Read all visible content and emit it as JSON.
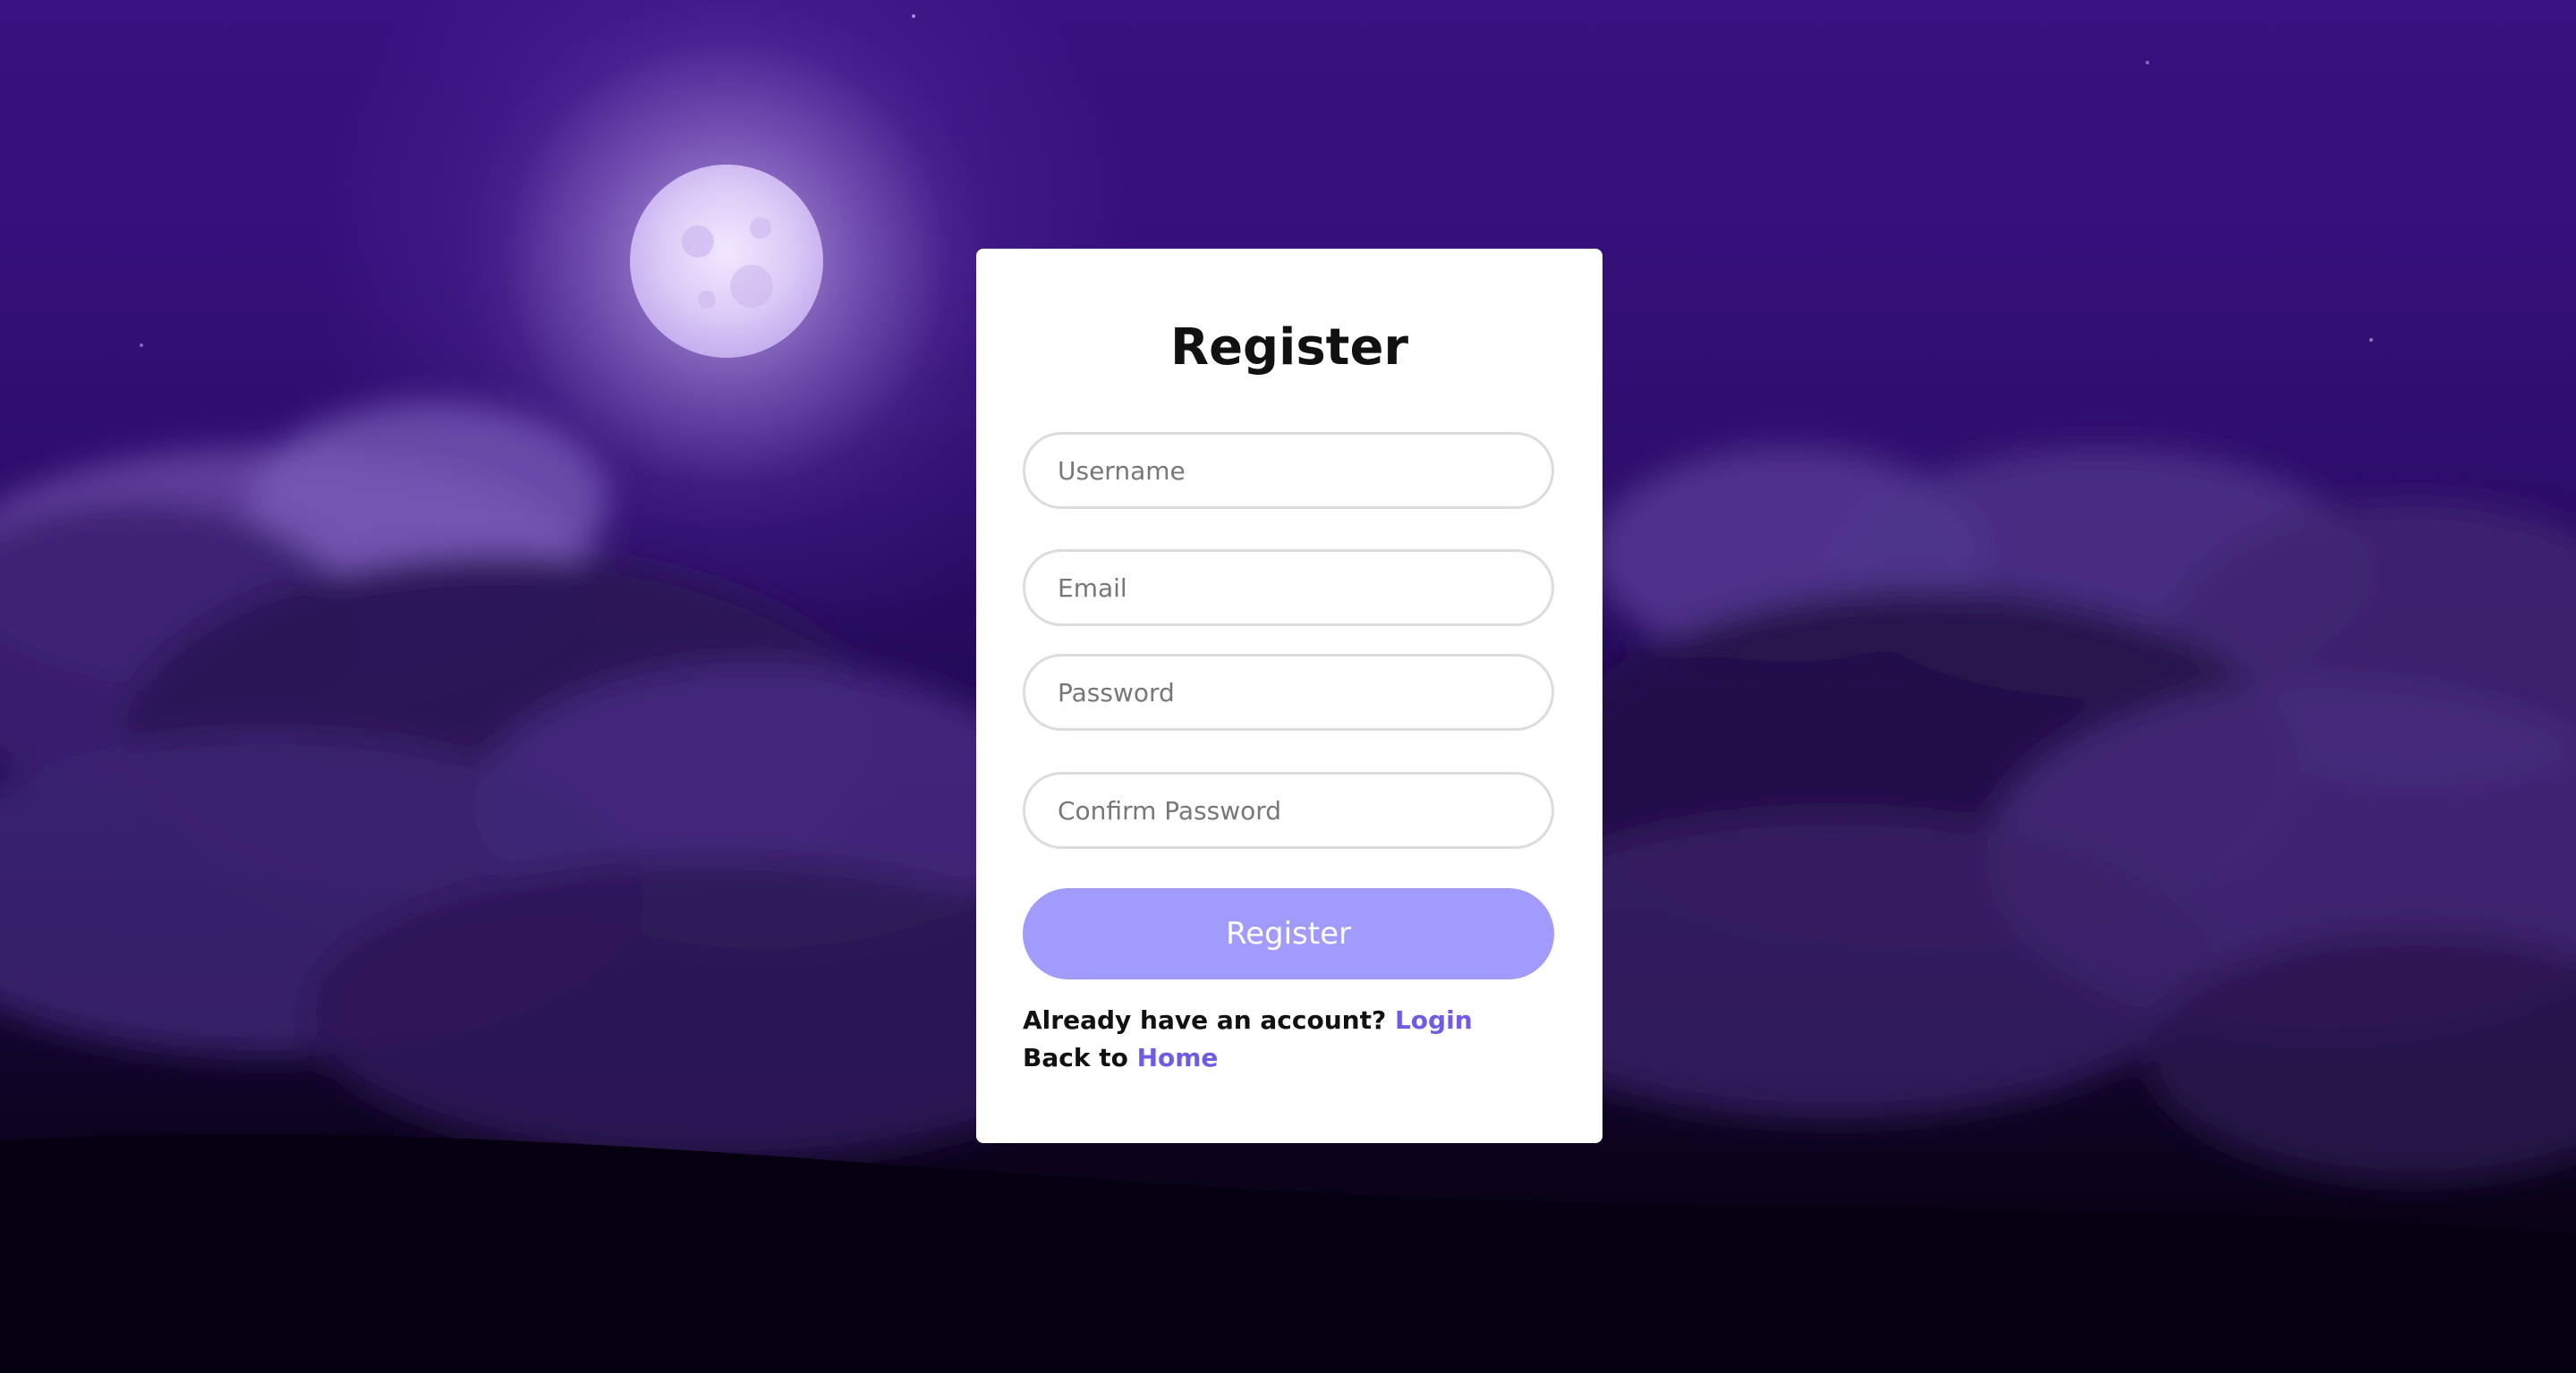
{
  "register_form": {
    "title": "Register",
    "username_placeholder": "Username",
    "email_placeholder": "Email",
    "password_placeholder": "Password",
    "confirm_password_placeholder": "Confirm Password",
    "submit_label": "Register",
    "login_prompt": "Already have an account?",
    "login_link": "Login",
    "home_prompt": "Back to",
    "home_link": "Home"
  },
  "colors": {
    "accent": "#6c5ce7",
    "button": "#a29bfe",
    "card": "#ffffff",
    "background": "#2a0c66"
  }
}
